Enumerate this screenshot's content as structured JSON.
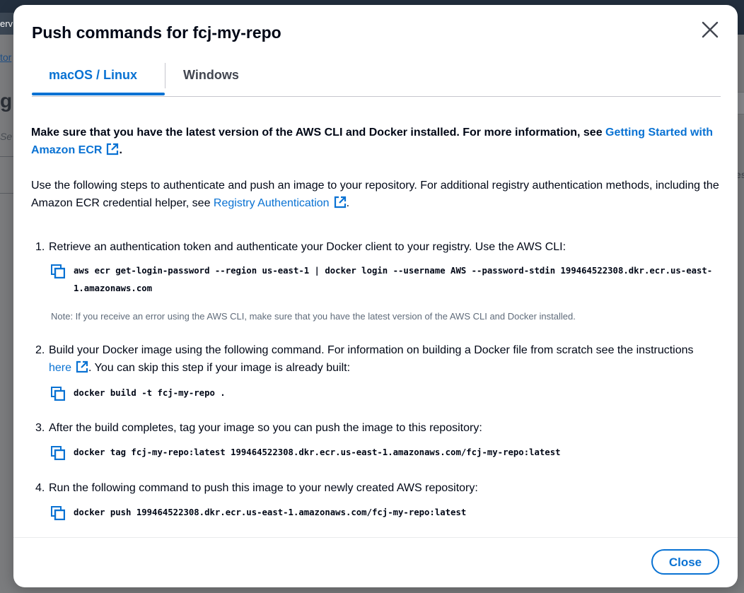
{
  "background": {
    "crumb_text": "erv",
    "link_fragment": "tor",
    "big_fragment": "g",
    "italic_fragment": "Se",
    "right_fragment": "es"
  },
  "modal": {
    "title": "Push commands for fcj-my-repo",
    "close_icon": "close-x-icon",
    "tabs": [
      {
        "label": "macOS / Linux",
        "active": true
      },
      {
        "label": "Windows",
        "active": false
      }
    ],
    "intro": {
      "text_before": "Make sure that you have the latest version of the AWS CLI and Docker installed. For more information, see ",
      "link": "Getting Started with Amazon ECR",
      "text_after": "."
    },
    "auth_para": {
      "text_before": "Use the following steps to authenticate and push an image to your repository. For additional registry authentication methods, including the Amazon ECR credential helper, see ",
      "link": "Registry Authentication",
      "text_after": "."
    },
    "steps": [
      {
        "number": "1.",
        "text": "Retrieve an authentication token and authenticate your Docker client to your registry. Use the AWS CLI:",
        "command": "aws ecr get-login-password --region us-east-1 | docker login --username AWS --password-stdin 199464522308.dkr.ecr.us-east-1.amazonaws.com",
        "note": "Note: If you receive an error using the AWS CLI, make sure that you have the latest version of the AWS CLI and Docker installed."
      },
      {
        "number": "2.",
        "text_before": "Build your Docker image using the following command. For information on building a Docker file from scratch see the instructions ",
        "link": "here",
        "text_after": ". You can skip this step if your image is already built:",
        "command": "docker build -t fcj-my-repo ."
      },
      {
        "number": "3.",
        "text": "After the build completes, tag your image so you can push the image to this repository:",
        "command": "docker tag fcj-my-repo:latest 199464522308.dkr.ecr.us-east-1.amazonaws.com/fcj-my-repo:latest"
      },
      {
        "number": "4.",
        "text": "Run the following command to push this image to your newly created AWS repository:",
        "command": "docker push 199464522308.dkr.ecr.us-east-1.amazonaws.com/fcj-my-repo:latest"
      }
    ],
    "footer": {
      "close_label": "Close"
    }
  },
  "colors": {
    "accent": "#0972d3",
    "text": "#000716",
    "muted": "#5f6b7a"
  }
}
